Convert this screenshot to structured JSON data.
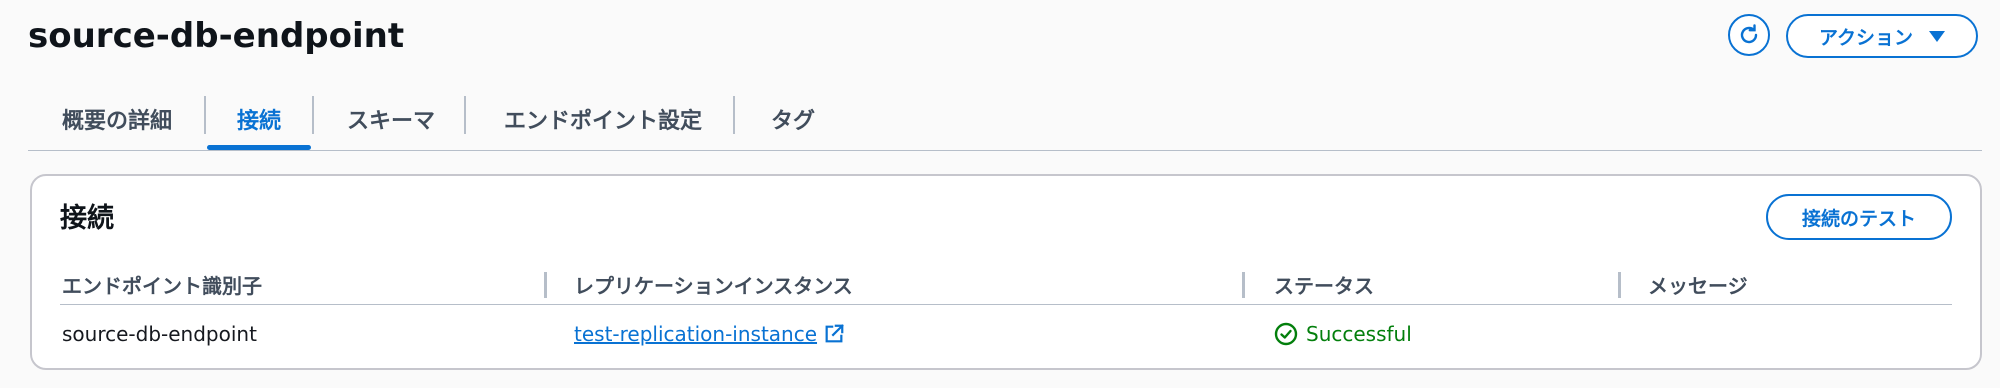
{
  "header": {
    "title": "source-db-endpoint",
    "refresh_icon": "refresh-icon",
    "actions_label": "アクション"
  },
  "tabs": [
    {
      "label": "概要の詳細",
      "active": false
    },
    {
      "label": "接続",
      "active": true
    },
    {
      "label": "スキーマ",
      "active": false
    },
    {
      "label": "エンドポイント設定",
      "active": false
    },
    {
      "label": "タグ",
      "active": false
    }
  ],
  "connections": {
    "title": "接続",
    "test_button_label": "接続のテスト",
    "columns": [
      "エンドポイント識別子",
      "レプリケーションインスタンス",
      "ステータス",
      "メッセージ"
    ],
    "rows": [
      {
        "endpoint_id": "source-db-endpoint",
        "replication_instance": "test-replication-instance",
        "status": "Successful",
        "message": ""
      }
    ]
  },
  "colors": {
    "accent": "#0972d3",
    "success": "#037f0c",
    "border": "#b6bec9"
  }
}
